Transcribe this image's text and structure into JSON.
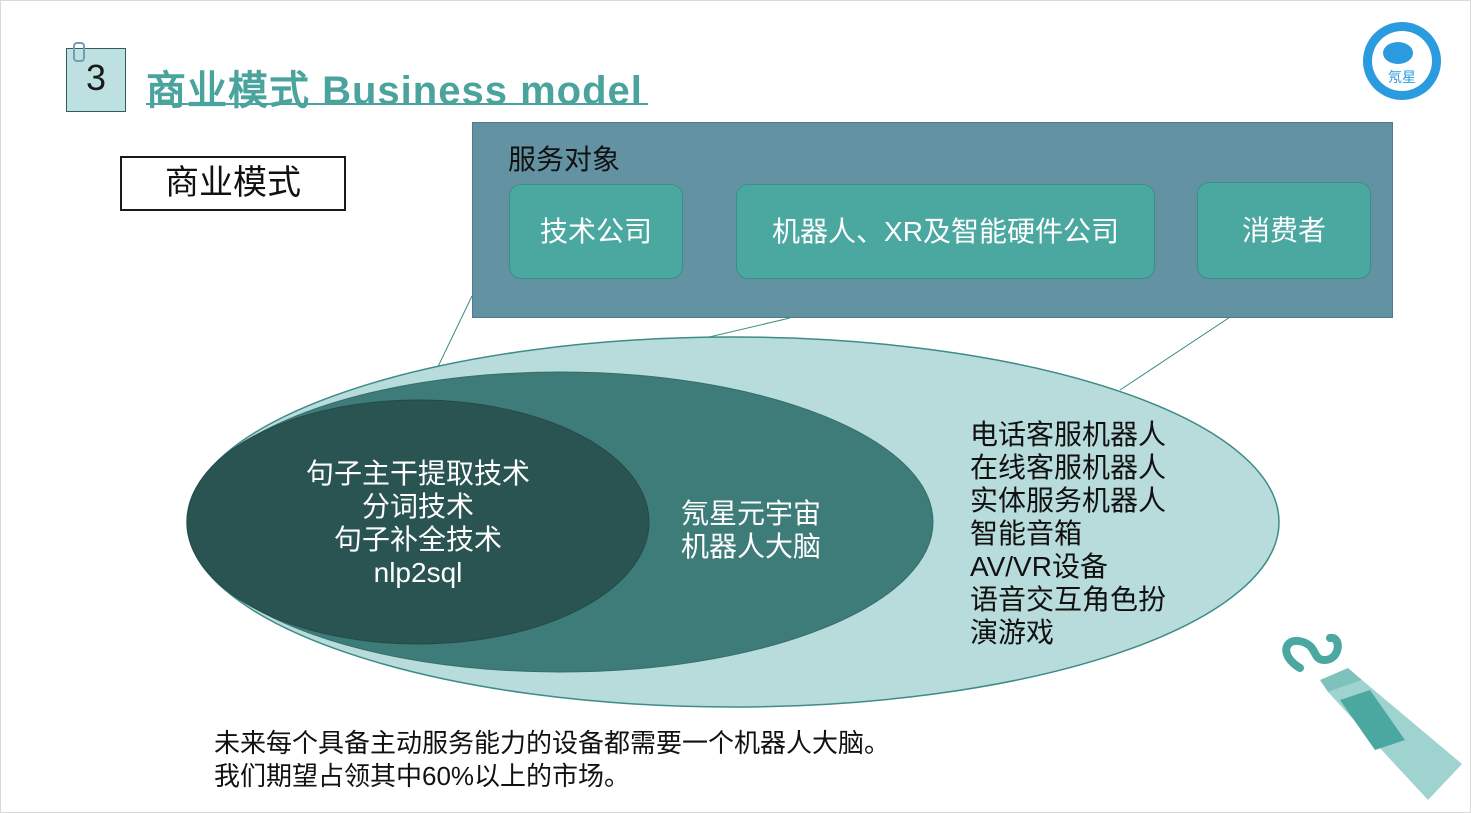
{
  "header": {
    "section_number": "3",
    "title": "商业模式 Business model"
  },
  "label": "商业模式",
  "service_targets": {
    "title": "服务对象",
    "items": [
      {
        "label": "技术公司"
      },
      {
        "label": "机器人、XR及智能硬件公司"
      },
      {
        "label": "消费者"
      }
    ]
  },
  "inner_core": {
    "lines": [
      "句子主干提取技术",
      "分词技术",
      "句子补全技术",
      "nlp2sql"
    ]
  },
  "middle_layer": {
    "lines": [
      "氖星元宇宙",
      "机器人大脑"
    ]
  },
  "applications": {
    "lines": [
      "电话客服机器人",
      "在线客服机器人",
      "实体服务机器人",
      "智能音箱",
      "AV/VR设备",
      "语音交互角色扮",
      "演游戏"
    ]
  },
  "footer": {
    "lines": [
      "未来每个具备主动服务能力的设备都需要一个机器人大脑。",
      "我们期望占领其中60%以上的市场。"
    ]
  },
  "logo": {
    "text": "氖星"
  },
  "colors": {
    "title": "#4aa39c",
    "panel": "#6393a3",
    "pill": "#4aa8a0",
    "outer_ellipse": "#b8dcdc",
    "middle_ellipse": "#3d7c79",
    "inner_ellipse": "#2a5452"
  }
}
